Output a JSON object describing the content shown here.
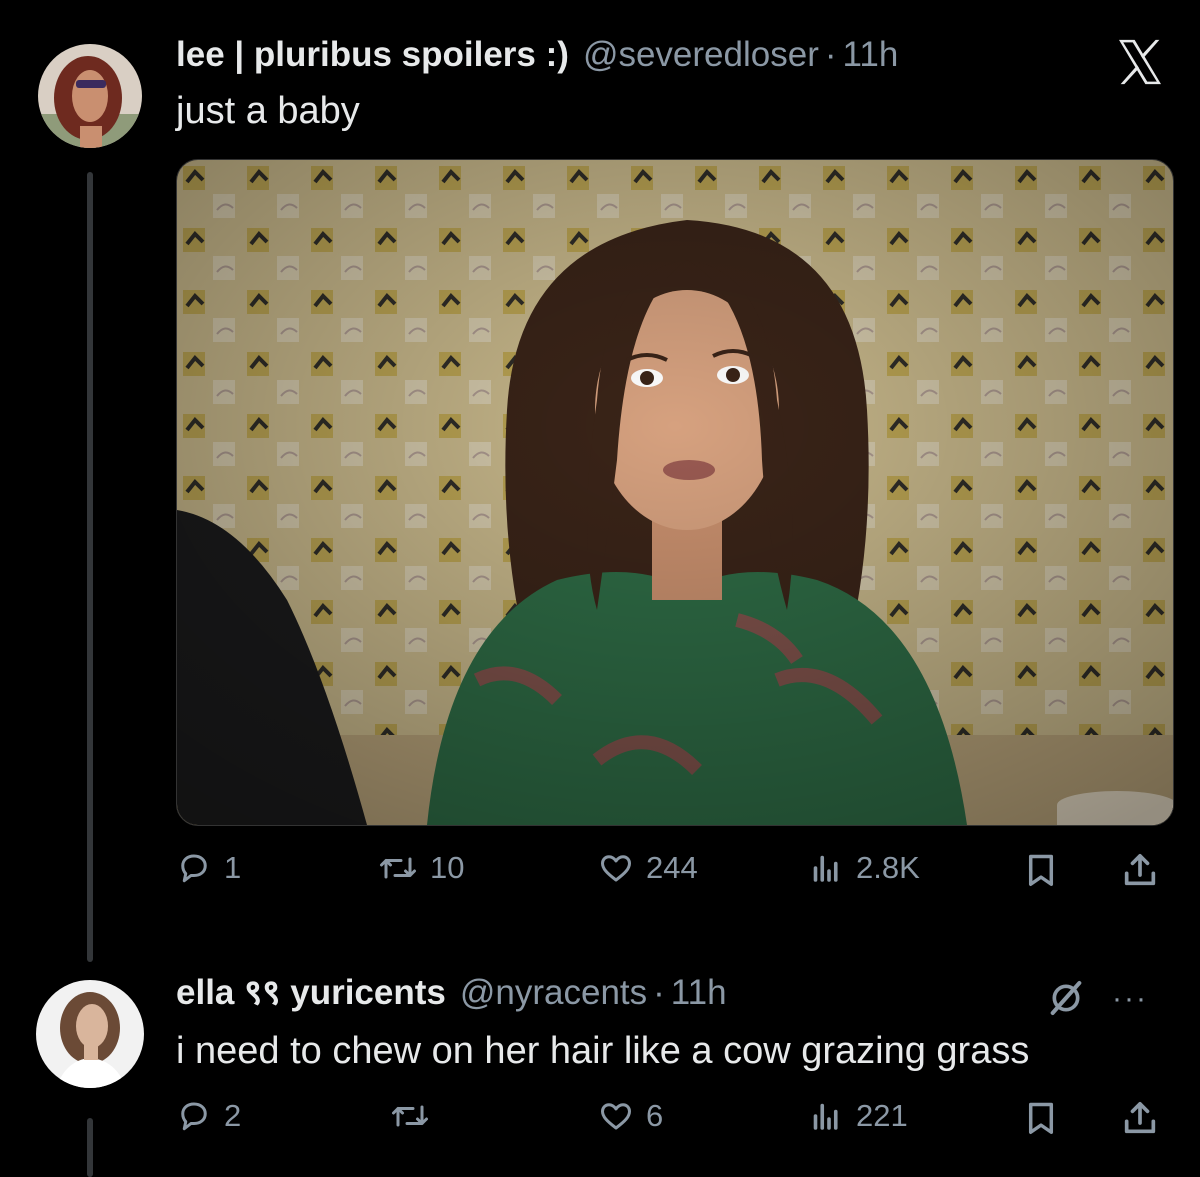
{
  "tweet1": {
    "display_name": "lee | pluribus spoilers :)",
    "handle": "@severedloser",
    "separator": "·",
    "time": "11h",
    "text": "just a baby",
    "replies": "1",
    "reposts": "10",
    "likes": "244",
    "views": "2.8K"
  },
  "tweet2": {
    "display_name": "ella ९९ yuricents",
    "handle": "@nyracents",
    "separator": "·",
    "time": "11h",
    "text": "i need to chew on her hair like a cow grazing grass",
    "replies": "2",
    "reposts": "",
    "likes": "6",
    "views": "221",
    "more_label": "···"
  },
  "icons": {
    "brand": "x-logo-icon",
    "reply": "reply-icon",
    "repost": "repost-icon",
    "like": "heart-icon",
    "views": "views-icon",
    "bookmark": "bookmark-icon",
    "share": "share-icon",
    "grok": "grok-icon"
  },
  "colors": {
    "background": "#000000",
    "text": "#e7e9ea",
    "secondary": "#8b98a5",
    "thread_line": "#333639"
  }
}
